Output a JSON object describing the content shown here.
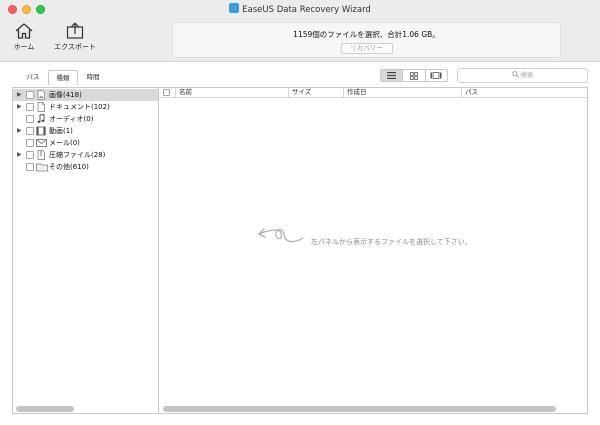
{
  "window": {
    "title": "EaseUS Data Recovery Wizard"
  },
  "toolbar": {
    "home_label": "ホーム",
    "export_label": "エクスポート"
  },
  "status": {
    "summary": "1159個のファイルを選択、合計1.06 GB。",
    "recover_label": "リカバリー"
  },
  "tabs": [
    {
      "label": "パス"
    },
    {
      "label": "種類",
      "active": true
    },
    {
      "label": "時間"
    }
  ],
  "views": [
    {
      "icon": "list-view-icon",
      "active": true
    },
    {
      "icon": "grid-view-icon",
      "active": false
    },
    {
      "icon": "preview-view-icon",
      "active": false
    }
  ],
  "search": {
    "placeholder": "検索"
  },
  "tree": [
    {
      "label": "画像(418)",
      "icon": "image-file-icon",
      "expandable": true,
      "selected": true
    },
    {
      "label": "ドキュメント(102)",
      "icon": "document-icon",
      "expandable": true,
      "selected": false
    },
    {
      "label": "オーディオ(0)",
      "icon": "music-note-icon",
      "expandable": false,
      "selected": false
    },
    {
      "label": "動画(1)",
      "icon": "film-icon",
      "expandable": true,
      "selected": false
    },
    {
      "label": "メール(0)",
      "icon": "mail-icon",
      "expandable": false,
      "selected": false
    },
    {
      "label": "圧縮ファイル(28)",
      "icon": "archive-icon",
      "expandable": true,
      "selected": false
    },
    {
      "label": "その他(610)",
      "icon": "folder-icon",
      "expandable": false,
      "selected": false
    }
  ],
  "table": {
    "columns": [
      "名前",
      "サイズ",
      "作成日",
      "パス"
    ]
  },
  "empty_message": "左パネルから表示するファイルを選択して下さい。",
  "colors": {
    "close": "#fc605c",
    "minimize": "#fdbc40",
    "maximize": "#34c84a",
    "app_icon": "#3aa0e0",
    "selection": "#d9d9d9"
  }
}
